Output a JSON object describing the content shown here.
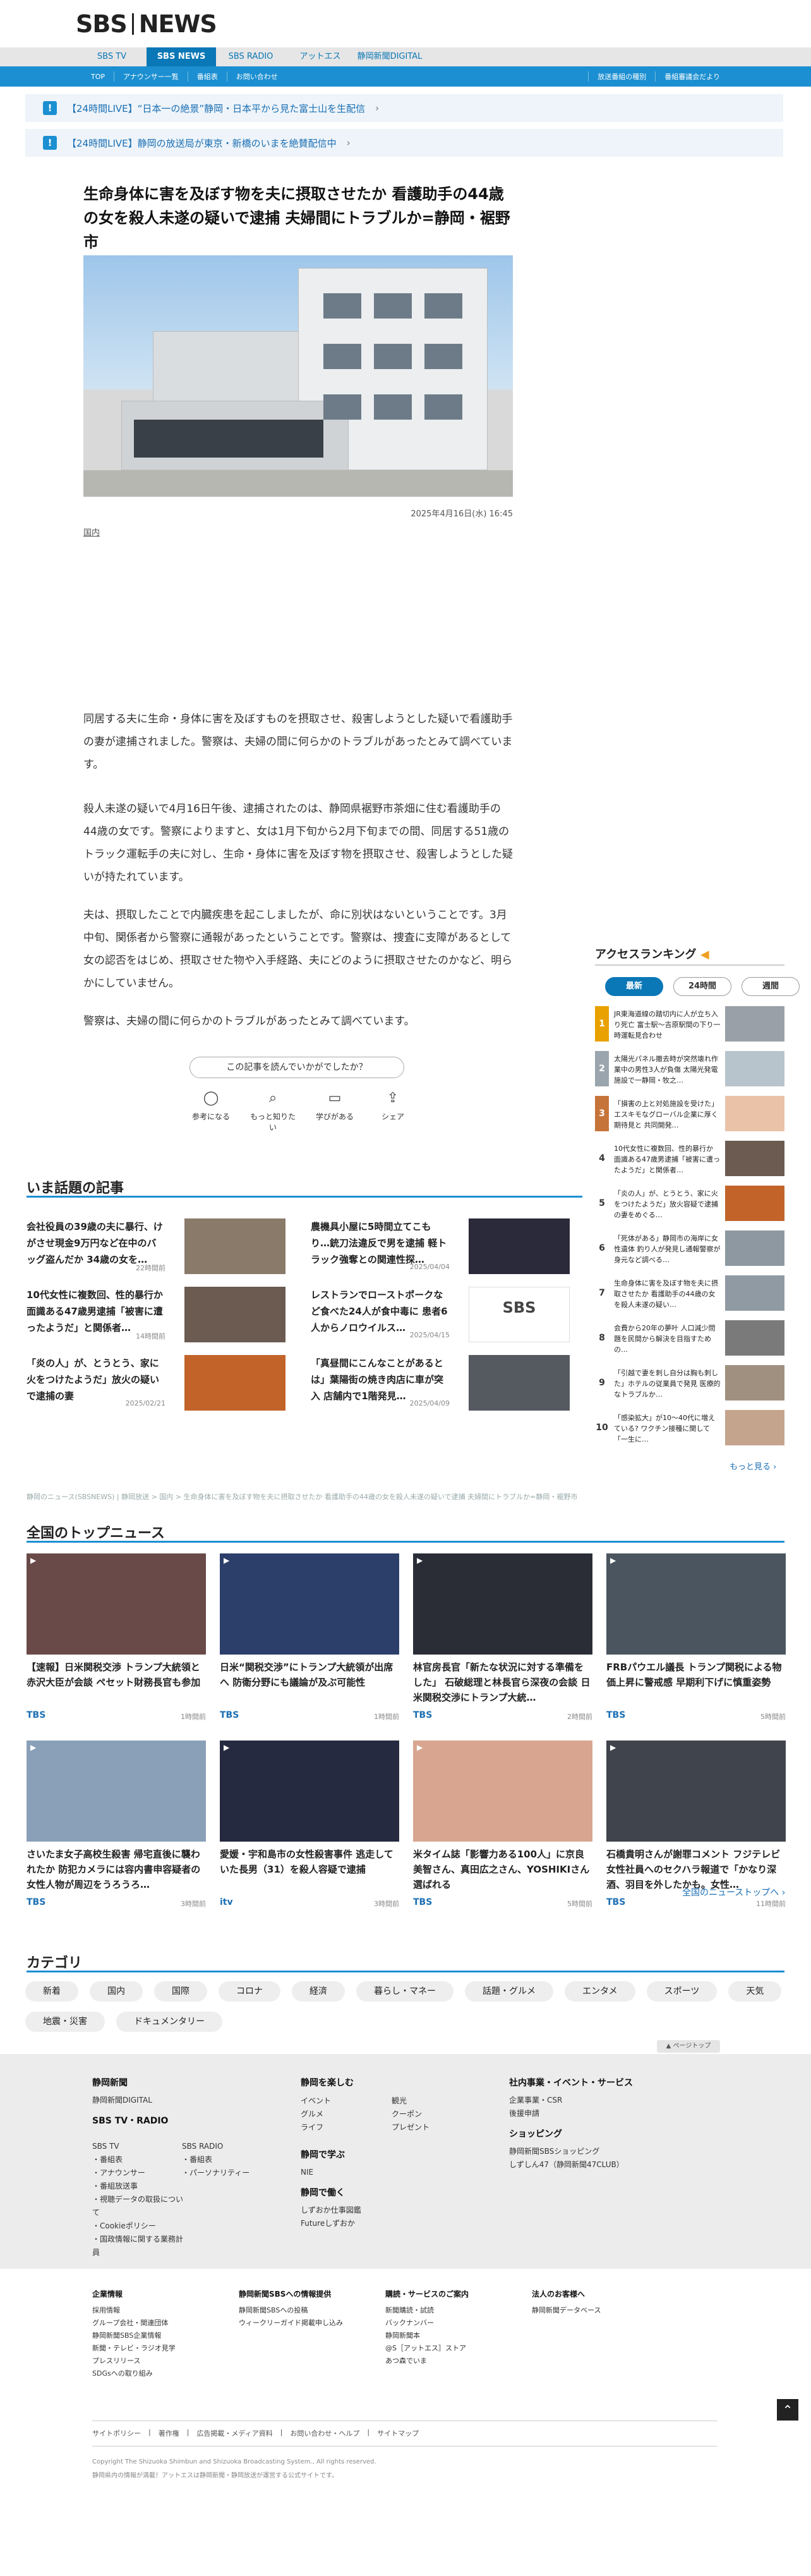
{
  "brand": {
    "logo_left": "SBS",
    "logo_right": "NEWS"
  },
  "nav": {
    "primary": [
      "SBS TV",
      "SBS NEWS",
      "SBS RADIO",
      "アットエス",
      "静岡新聞DIGITAL"
    ],
    "secondary": [
      "TOP",
      "アナウンサー一覧",
      "番組表",
      "お問い合わせ"
    ],
    "secondary_right": [
      "放送番組の種別",
      "番組審議会だより"
    ]
  },
  "alerts": [
    "【24時間LIVE】“日本一の絶景”静岡・日本平から見た富士山を生配信",
    "【24時間LIVE】静岡の放送局が東京・新橋のいまを絶賛配信中"
  ],
  "article": {
    "title": "生命身体に害を及ぼす物を夫に摂取させたか 看護助手の44歳の女を殺人未遂の疑いで逮捕 夫婦間にトラブルか=静岡・裾野市",
    "date": "2025年4月16日(水) 16:45",
    "category": "国内",
    "paragraphs": [
      "同居する夫に生命・身体に害を及ぼすものを摂取させ、殺害しようとした疑いで看護助手の妻が逮捕されました。警察は、夫婦の間に何らかのトラブルがあったとみて調べています。",
      "殺人未遂の疑いで4月16日午後、逮捕されたのは、静岡県裾野市茶畑に住む看護助手の44歳の女です。警察によりますと、女は1月下旬から2月下旬までの間、同居する51歳のトラック運転手の夫に対し、生命・身体に害を及ぼす物を摂取させ、殺害しようとした疑いが持たれています。",
      "夫は、摂取したことで内臓疾患を起こしましたが、命に別状はないということです。3月中旬、関係者から警察に通報があったということです。警察は、捜査に支障があるとして女の認否をはじめ、摂取させた物や入手経路、夫にどのように摂取させたのかなど、明らかにしていません。",
      "警察は、夫婦の間に何らかのトラブルがあったとみて調べています。"
    ],
    "feedback_question": "この記事を読んでいかがでしたか？",
    "reactions": [
      "参考になる",
      "もっと知りたい",
      "学びがある",
      "シェア"
    ]
  },
  "trending": {
    "heading": "いま話題の記事",
    "items": [
      {
        "text": "会社役員の39歳の夫に暴行、けがさせ現金9万円など在中のバッグ盗んだか 34歳の女を…",
        "time": "22時間前",
        "tone": "#8a7a6a"
      },
      {
        "text": "農機具小屋に5時間立てこもり…銃刀法違反で男を逮捕 軽トラック強奪との関連性探…",
        "time": "2025/04/04",
        "tone": "#2a2a3a"
      },
      {
        "text": "10代女性に複数回、性的暴行か 面識ある47歳男逮捕「被害に遭ったようだ」と関係者…",
        "time": "14時間前",
        "tone": "#6b5b50"
      },
      {
        "text": "レストランでローストポークなど食べた24人が食中毒に 患者6人からノロウイルス…",
        "time": "2025/04/15",
        "tone": "#ffffff"
      },
      {
        "text": "「炎の人」が、とうとう、家に火をつけたようだ」放火の疑いで逮捕の妻",
        "time": "2025/02/21",
        "tone": "#c2642a"
      },
      {
        "text": "「真昼間にこんなことがあるとは」葉陽街の焼き肉店に車が突入 店舗内で1階発見…",
        "time": "2025/04/09",
        "tone": "#555a60"
      }
    ]
  },
  "ranking": {
    "heading": "アクセスランキング",
    "tabs": [
      "最新",
      "24時間",
      "週間"
    ],
    "items": [
      {
        "text": "JR東海道線の踏切内に人が立ち入り死亡 富士駅〜吉原駅間の下り一時運転見合わせ",
        "tone": "#9aa0a8"
      },
      {
        "text": "太陽光パネル撤去時が突然壊れ作業中の男性3人が負傷 太陽光発電施設で一静岡・牧之…",
        "tone": "#b8c4cc"
      },
      {
        "text": "「損害の上と対処施設を受けた」エスキモなグローバル企業に厚く期待見と 共同開発…",
        "tone": "#e9c2a8"
      },
      {
        "text": "10代女性に複数回、性的暴行か 面識ある47歳男逮捕「被害に遭ったようだ」と関係者…",
        "tone": "#6b5b50"
      },
      {
        "text": "「炎の人」が、とうとう、家に火をつけたようだ」放火容疑で逮捕の妻をめぐる…",
        "tone": "#c2642a"
      },
      {
        "text": "「死体がある」静岡市の海岸に女性遺体 釣り人が発見し通報警察が身元など調べる…",
        "tone": "#8d98a0"
      },
      {
        "text": "生命身体に害を及ぼす物を夫に摂取させたか 看護助手の44歳の女を殺人未遂の疑い…",
        "tone": "#8f9aa3"
      },
      {
        "text": "会費から20年の夢叶 人口減少問題を民間から解決を目指すための…",
        "tone": "#7a7a7a"
      },
      {
        "text": "「引越で妻を刺し自分は胸も刺した」ホテルの従業員で発見 医療的なトラブルか…",
        "tone": "#a09080"
      },
      {
        "text": "「感染拡大」が10〜40代に増えている? ワクチン接種に関して「一生に…",
        "tone": "#c4a48c"
      }
    ],
    "more": "もっと見る"
  },
  "breadcrumb": "静岡のニュース(SBSNEWS) | 静岡放送 > 国内 > 生命身体に害を及ぼす物を夫に摂取させたか 看護助手の44歳の女を殺人未遂の疑いで逮捕 夫婦間にトラブルか=静岡・裾野市",
  "national": {
    "heading": "全国のトップニュース",
    "items": [
      {
        "text": "【速報】日米関税交渉 トランプ大統領と赤沢大臣が会談 ペセット財務長官も参加",
        "src": "TBS",
        "time": "1時間前",
        "tone": "#6a4a48"
      },
      {
        "text": "日米“関税交渉”にトランプ大統領が出席へ 防衛分野にも議論が及ぶ可能性",
        "src": "TBS",
        "time": "1時間前",
        "tone": "#2c3e6a"
      },
      {
        "text": "林官房長官「新たな状況に対する準備をした」 石破総理と林長官ら深夜の会談 日米関税交渉にトランプ大統…",
        "src": "TBS",
        "time": "2時間前",
        "tone": "#2a2d36"
      },
      {
        "text": "FRBパウエル議長 トランプ関税による物価上昇に警戒感 早期利下げに慎重姿勢",
        "src": "TBS",
        "time": "5時間前",
        "tone": "#4a5560"
      },
      {
        "text": "さいたま女子高校生殺害 帰宅直後に襲われたか 防犯カメラには容内書申容疑者の女性人物が周辺をうろうろ…",
        "src": "TBS",
        "time": "3時間前",
        "tone": "#8aa0b8"
      },
      {
        "text": "愛媛・宇和島市の女性殺害事件 逃走していた長男（31）を殺人容疑で逮捕",
        "src": "itv",
        "time": "3時間前",
        "tone": "#262a40"
      },
      {
        "text": "米タイム誌「影響力ある100人」に京良美智さん、真田広之さん、YOSHIKIさん選ばれる",
        "src": "TBS",
        "time": "5時間前",
        "tone": "#d8a690"
      },
      {
        "text": "石橋貴明さんが謝罪コメント フジテレビ女性社員へのセクハラ報道で「かなり深酒、羽目を外したかも。女性…",
        "src": "TBS",
        "time": "11時間前",
        "tone": "#40444c"
      }
    ],
    "more": "全国のニューストップへ"
  },
  "categories": {
    "heading": "カテゴリ",
    "items": [
      "新着",
      "国内",
      "国際",
      "コロナ",
      "経済",
      "暮らし・マネー",
      "話題・グルメ",
      "エンタメ",
      "スポーツ",
      "天気",
      "地震・災害",
      "ドキュメンタリー"
    ]
  },
  "page_top": "ページトップ",
  "footer": {
    "col1_title": "静岡新聞",
    "col1_items": [
      "静岡新聞DIGITAL"
    ],
    "col1b_title": "SBS TV・RADIO",
    "col1b_tv": [
      "SBS TV",
      "・番組表",
      "・アナウンサー",
      "・番組放送事",
      "・視聴データの取扱について",
      "・Cookieポリシー",
      "・国政情報に関する業務計員"
    ],
    "col1b_radio": [
      "SBS RADIO",
      "・番組表",
      "・パーソナリティー"
    ],
    "col2_title": "静岡を楽しむ",
    "col2_items": [
      "イベント",
      "グルメ",
      "ライフ"
    ],
    "col2_items_b": [
      "観光",
      "クーポン",
      "プレゼント"
    ],
    "col2b_title": "静岡で学ぶ",
    "col2b_items": [
      "NIE"
    ],
    "col2c_title": "静岡で働く",
    "col2c_items": [
      "しずおか仕事図鑑",
      "Futureしずおか"
    ],
    "col3_title": "社内事業・イベント・サービス",
    "col3_items": [
      "企業事業・CSR",
      "後援申請"
    ],
    "col3b_title": "ショッピング",
    "col3b_items": [
      "静岡新聞SBSショッピング",
      "しずしん47（静岡新聞47CLUB）"
    ],
    "bottom_cols": [
      {
        "title": "企業情報",
        "items": [
          "採用情報",
          "グループ会社・関連団体",
          "静岡新聞SBS企業情報",
          "新聞・テレビ・ラジオ見学",
          "プレスリリース",
          "SDGsへの取り組み"
        ]
      },
      {
        "title": "静岡新聞SBSへの情報提供",
        "items": [
          "静岡新聞SBSへの投稿",
          "ウィークリーガイド掲載申し込み"
        ]
      },
      {
        "title": "購読・サービスのご案内",
        "items": [
          "新聞購読・試読",
          "バックナンバー",
          "静岡新聞本",
          "@S［アットエス］ストア",
          "あつ森でいま"
        ]
      },
      {
        "title": "法人のお客様へ",
        "items": [
          "静岡新聞データベース"
        ]
      }
    ],
    "links": [
      "サイトポリシー",
      "著作権",
      "広告掲載・メディア資料",
      "お問い合わせ・ヘルプ",
      "サイトマップ"
    ],
    "copyright": "Copyright The Shizuoka Shimbun and Shizuoka Broadcasting System., All rights reserved.",
    "copyright2": "静岡県内の情報が満載！アットエスは静岡新聞・静岡放送が運営する公式サイトです。"
  }
}
